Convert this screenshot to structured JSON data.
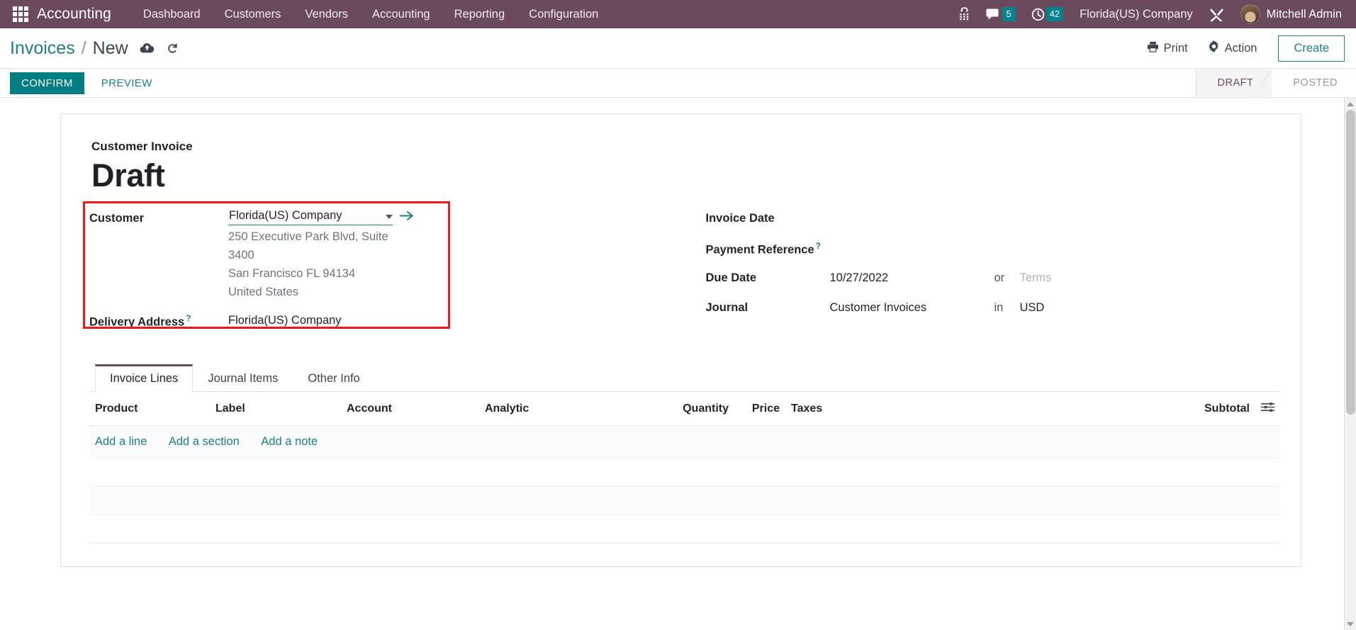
{
  "navbar": {
    "apps_icon": "apps-grid-icon",
    "brand": "Accounting",
    "menu": [
      {
        "label": "Dashboard"
      },
      {
        "label": "Customers"
      },
      {
        "label": "Vendors"
      },
      {
        "label": "Accounting"
      },
      {
        "label": "Reporting"
      },
      {
        "label": "Configuration"
      }
    ],
    "right": {
      "voip_icon": "phone-keypad-icon",
      "messages_icon": "chat-bubble-icon",
      "messages_count": "5",
      "activities_icon": "clock-icon",
      "activities_count": "42",
      "company": "Florida(US) Company",
      "debug_icon": "tools-wrench-icon",
      "user_name": "Mitchell Admin",
      "avatar": "user-avatar"
    }
  },
  "control_panel": {
    "breadcrumb_root": "Invoices",
    "breadcrumb_sep": "/",
    "breadcrumb_current": "New",
    "save_icon": "cloud-upload-icon",
    "discard_icon": "undo-icon",
    "print_label": "Print",
    "print_icon": "printer-icon",
    "action_label": "Action",
    "action_icon": "gear-icon",
    "create_label": "Create"
  },
  "statusbar": {
    "confirm_label": "CONFIRM",
    "preview_label": "PREVIEW",
    "stages": [
      {
        "label": "DRAFT",
        "active": true
      },
      {
        "label": "POSTED",
        "active": false
      }
    ]
  },
  "form": {
    "doc_subtitle": "Customer Invoice",
    "doc_title": "Draft",
    "left": {
      "customer_label": "Customer",
      "customer_value": "Florida(US) Company",
      "customer_placeholder": "Customer",
      "dropdown_icon": "chevron-down-icon",
      "internal_link_icon": "arrow-right-icon",
      "address_lines": [
        "250 Executive Park Blvd, Suite",
        "3400",
        "San Francisco FL 94134",
        "United States"
      ],
      "delivery_label": "Delivery Address",
      "delivery_help": "?",
      "delivery_value": "Florida(US) Company"
    },
    "right": {
      "invoice_date_label": "Invoice Date",
      "invoice_date_value": "",
      "payment_reference_label": "Payment Reference",
      "payment_reference_help": "?",
      "payment_reference_value": "",
      "due_date_label": "Due Date",
      "due_date_value": "10/27/2022",
      "or_word": "or",
      "terms_placeholder": "Terms",
      "journal_label": "Journal",
      "journal_value": "Customer Invoices",
      "in_word": "in",
      "currency_value": "USD"
    }
  },
  "notebook": {
    "tabs": [
      {
        "label": "Invoice Lines",
        "active": true
      },
      {
        "label": "Journal Items",
        "active": false
      },
      {
        "label": "Other Info",
        "active": false
      }
    ]
  },
  "lines_table": {
    "columns": [
      "Product",
      "Label",
      "Account",
      "Analytic",
      "Quantity",
      "Price",
      "Taxes",
      "Subtotal"
    ],
    "settings_icon": "column-options-icon",
    "add_line": "Add a line",
    "add_section": "Add a section",
    "add_note": "Add a note",
    "rows": []
  },
  "scrollbar": {
    "up_icon": "scroll-up-arrow",
    "down_icon": "scroll-down-arrow"
  },
  "colors": {
    "navbar_bg": "#6b4a5e",
    "accent_teal": "#1d7f84",
    "primary_button": "#017e84",
    "badge": "#00828f",
    "highlight_red": "#f31818"
  }
}
